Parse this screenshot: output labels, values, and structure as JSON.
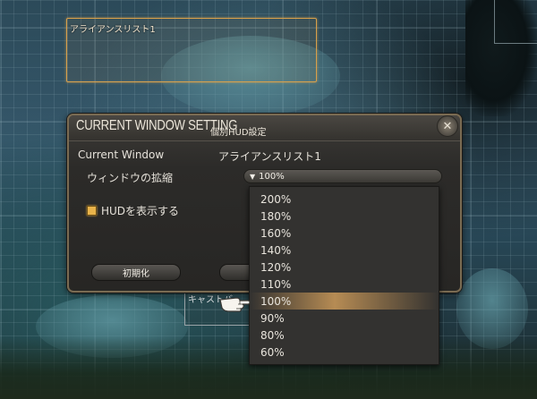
{
  "hud": {
    "alliance_frame_label": "アライアンスリスト1",
    "cast_frame_label": "キャストバ"
  },
  "window": {
    "title": "CURRENT WINDOW SETTING",
    "subtitle": "個別HUD設定",
    "current_window_label": "Current Window",
    "current_window_value": "アライアンスリスト1",
    "scale_label": "ウィンドウの拡縮",
    "scale_value": "100%",
    "show_hud_label": "HUDを表示する",
    "show_hud_checked": true,
    "reset_button": "初期化"
  },
  "dropdown": {
    "options": [
      "200%",
      "180%",
      "160%",
      "140%",
      "120%",
      "110%",
      "100%",
      "90%",
      "80%",
      "60%"
    ],
    "selected": "100%"
  },
  "icons": {
    "close": "close-icon",
    "dropdown_arrow": "chevron-down-icon",
    "cursor": "pointing-hand-cursor-icon"
  },
  "colors": {
    "accent": "#e8b34a",
    "window_border": "#7a6b52",
    "highlight": "#cd9b5a"
  }
}
